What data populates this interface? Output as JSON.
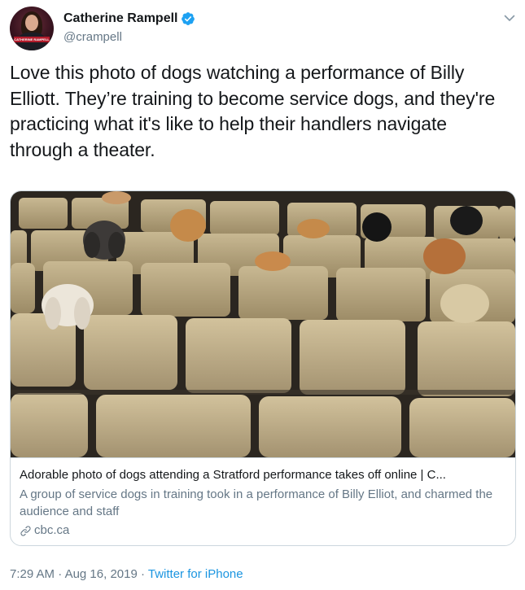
{
  "author": {
    "display_name": "Catherine Rampell",
    "handle": "@crampell",
    "avatar_caption": "CATHERINE RAMPELL"
  },
  "tweet": {
    "text": "Love this photo of dogs watching a performance of Billy Elliott. They’re training to become service dogs, and they're practicing what it's like to help their handlers navigate through a theater."
  },
  "card": {
    "title": "Adorable photo of dogs attending a Stratford performance takes off online | C...",
    "description": "A group of service dogs in training took in a performance of Billy Elliot, and charmed the audience and staff",
    "domain": "cbc.ca"
  },
  "meta": {
    "time": "7:29 AM",
    "separator1": " · ",
    "date": "Aug 16, 2019",
    "separator2": " · ",
    "source": "Twitter for iPhone"
  },
  "colors": {
    "text": "#14171a",
    "secondary": "#657786",
    "accent": "#1b95e0",
    "verified": "#1da1f2",
    "border": "#ccd6dd"
  }
}
